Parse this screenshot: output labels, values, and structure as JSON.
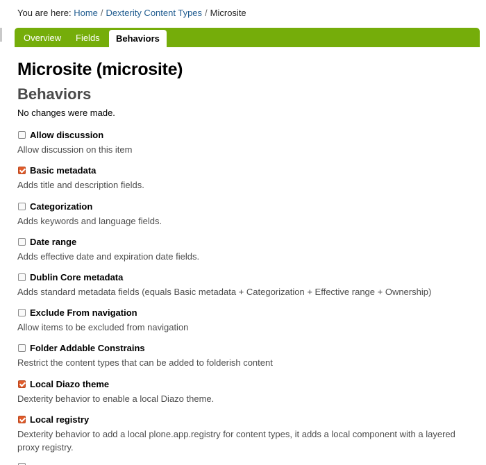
{
  "breadcrumb": {
    "prefix": "You are here:",
    "items": [
      "Home",
      "Dexterity Content Types"
    ],
    "current": "Microsite",
    "separator": "/"
  },
  "tabs": [
    {
      "label": "Overview",
      "active": false
    },
    {
      "label": "Fields",
      "active": false
    },
    {
      "label": "Behaviors",
      "active": true
    }
  ],
  "page": {
    "title": "Microsite (microsite)",
    "section": "Behaviors",
    "status": "No changes were made."
  },
  "behaviors": [
    {
      "label": "Allow discussion",
      "description": "Allow discussion on this item",
      "checked": false
    },
    {
      "label": "Basic metadata",
      "description": "Adds title and description fields.",
      "checked": true
    },
    {
      "label": "Categorization",
      "description": "Adds keywords and language fields.",
      "checked": false
    },
    {
      "label": "Date range",
      "description": "Adds effective date and expiration date fields.",
      "checked": false
    },
    {
      "label": "Dublin Core metadata",
      "description": "Adds standard metadata fields (equals Basic metadata + Categorization + Effective range + Ownership)",
      "checked": false
    },
    {
      "label": "Exclude From navigation",
      "description": "Allow items to be excluded from navigation",
      "checked": false
    },
    {
      "label": "Folder Addable Constrains",
      "description": "Restrict the content types that can be added to folderish content",
      "checked": false
    },
    {
      "label": "Local Diazo theme",
      "description": "Dexterity behavior to enable a local Diazo theme.",
      "checked": true
    },
    {
      "label": "Local registry",
      "description": "Dexterity behavior to add a local plone.app.registry for content types, it adds a local component with a layered proxy registry.",
      "checked": true
    }
  ],
  "colors": {
    "tab_bar": "#75ad0a",
    "link": "#205c90",
    "checkbox_checked": "#e05c2b"
  }
}
